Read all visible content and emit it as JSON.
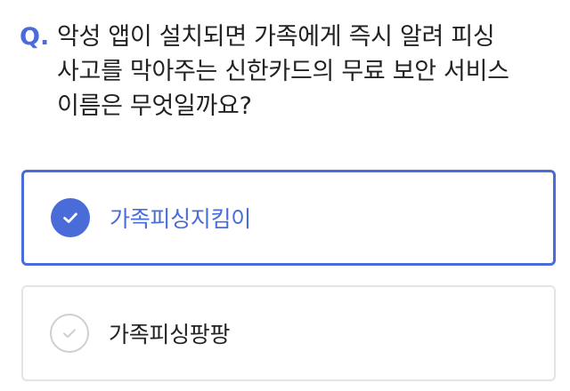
{
  "question": {
    "prefix": "Q.",
    "text": "악성 앱이 설치되면 가족에게 즉시 알려 피싱 사고를 막아주는 신한카드의 무료 보안 서비스 이름은 무엇일까요?"
  },
  "options": [
    {
      "label": "가족피싱지킴이",
      "selected": true,
      "icon": "check-icon"
    },
    {
      "label": "가족피싱팡팡",
      "selected": false,
      "icon": "check-icon"
    }
  ],
  "colors": {
    "accent": "#4a6cd9",
    "text": "#222222",
    "border_unselected": "#e4e4e4"
  }
}
